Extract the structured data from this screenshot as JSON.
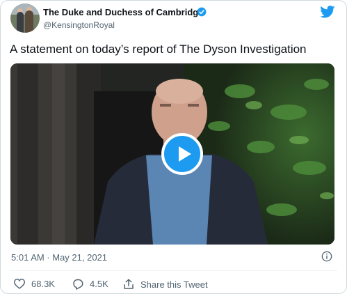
{
  "account": {
    "display_name": "The Duke and Duchess of Cambridge",
    "handle": "@KensingtonRoyal",
    "verified_icon": "verified-badge-icon",
    "brand_icon": "twitter-bird-icon"
  },
  "tweet": {
    "text": "A statement on today’s report of The Dyson Investigation",
    "media": {
      "type": "video",
      "play_icon": "play-icon"
    },
    "timestamp": "5:01 AM · May 21, 2021"
  },
  "actions": {
    "likes": "68.3K",
    "replies": "4.5K",
    "share_label": "Share this Tweet"
  },
  "colors": {
    "accent": "#1d9bf0",
    "like": "#536471",
    "text_primary": "#0f1419",
    "text_secondary": "#536471"
  }
}
